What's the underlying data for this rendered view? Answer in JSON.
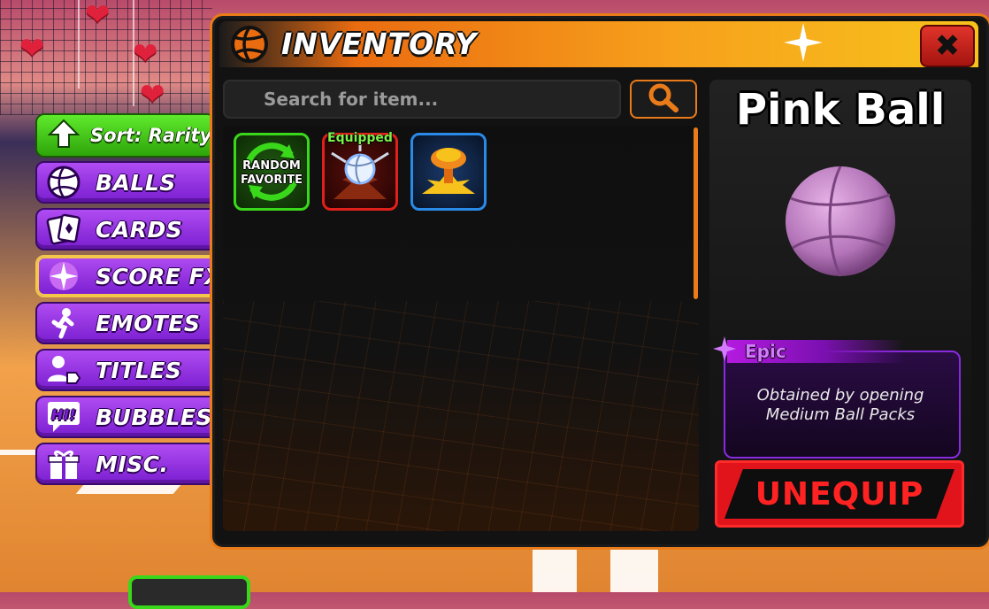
{
  "sort_button": {
    "label": "Sort: Rarity"
  },
  "tabs": [
    {
      "id": "balls",
      "label": "BALLS",
      "icon": "volleyball-icon"
    },
    {
      "id": "cards",
      "label": "CARDS",
      "icon": "cards-icon"
    },
    {
      "id": "scorefx",
      "label": "SCORE FX",
      "icon": "sparkle-burst-icon",
      "active": true
    },
    {
      "id": "emotes",
      "label": "EMOTES",
      "icon": "dancing-figure-icon"
    },
    {
      "id": "titles",
      "label": "TITLES",
      "icon": "user-tag-icon"
    },
    {
      "id": "bubbles",
      "label": "BUBBLES",
      "icon": "speech-bubble-icon"
    },
    {
      "id": "misc",
      "label": "MISC.",
      "icon": "gift-icon"
    }
  ],
  "inventory": {
    "title": "INVENTORY",
    "search_placeholder": "Search for item...",
    "items": [
      {
        "name": "random-favorite",
        "label_line1": "RANDOM",
        "label_line2": "FAVORITE",
        "border": "#3ad81a"
      },
      {
        "name": "equipped-item",
        "tag": "Equipped",
        "border": "#e0201a"
      },
      {
        "name": "explosion-fx",
        "border": "#2a8ae8"
      }
    ]
  },
  "detail": {
    "item_name": "Pink Ball",
    "rarity": "Epic",
    "description": "Obtained by opening Medium Ball Packs",
    "action_button": "UNEQUIP"
  },
  "colors": {
    "accent_orange": "#ea7b1a",
    "tab_purple": "#9a34e8",
    "sort_green": "#3ad81a",
    "epic_purple": "#b41ae0",
    "unequip_red": "#e0141a"
  }
}
